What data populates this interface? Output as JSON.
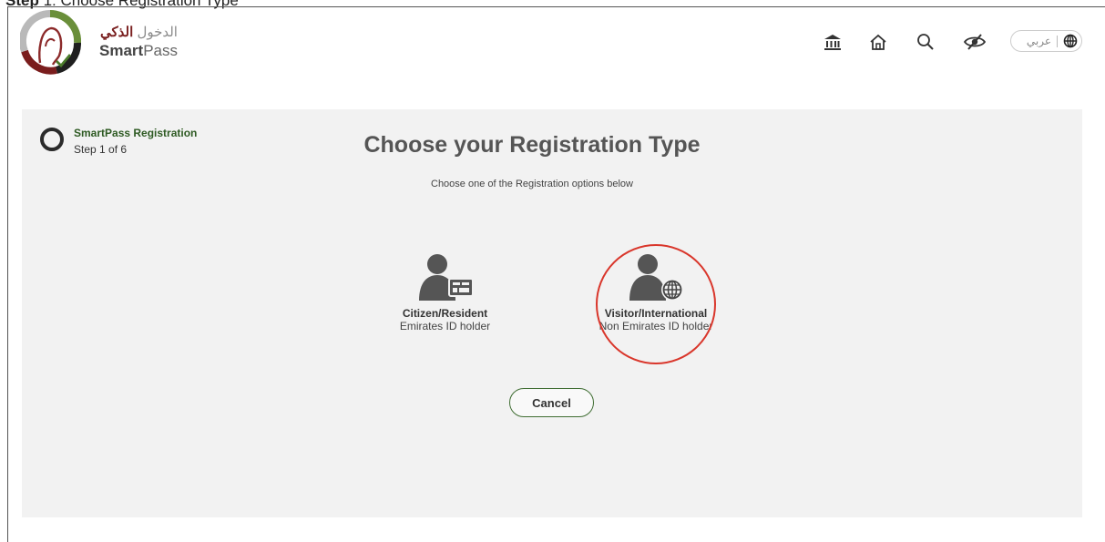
{
  "caption": {
    "bold": "Step",
    "rest": "1: Choose Registration Type"
  },
  "brand": {
    "arabic_light": "الدخول",
    "arabic_bold": "الذكي",
    "english_bold": "Smart",
    "english_light": "Pass"
  },
  "nav": {
    "icons": [
      "government-icon",
      "home-icon",
      "search-icon",
      "accessibility-icon"
    ],
    "language_label": "عربي"
  },
  "step": {
    "title": "SmartPass Registration",
    "progress": "Step 1 of 6"
  },
  "main": {
    "title": "Choose your Registration Type",
    "subtitle": "Choose one of the Registration options below"
  },
  "options": [
    {
      "title": "Citizen/Resident",
      "subtitle": "Emirates ID holder",
      "icon": "id-card-user-icon"
    },
    {
      "title": "Visitor/International",
      "subtitle": "Non Emirates ID holder",
      "icon": "globe-user-icon"
    }
  ],
  "cancel_label": "Cancel",
  "colors": {
    "panel": "#f2f2f2",
    "brand_green": "#3f6d32",
    "highlight": "#d9362b"
  }
}
